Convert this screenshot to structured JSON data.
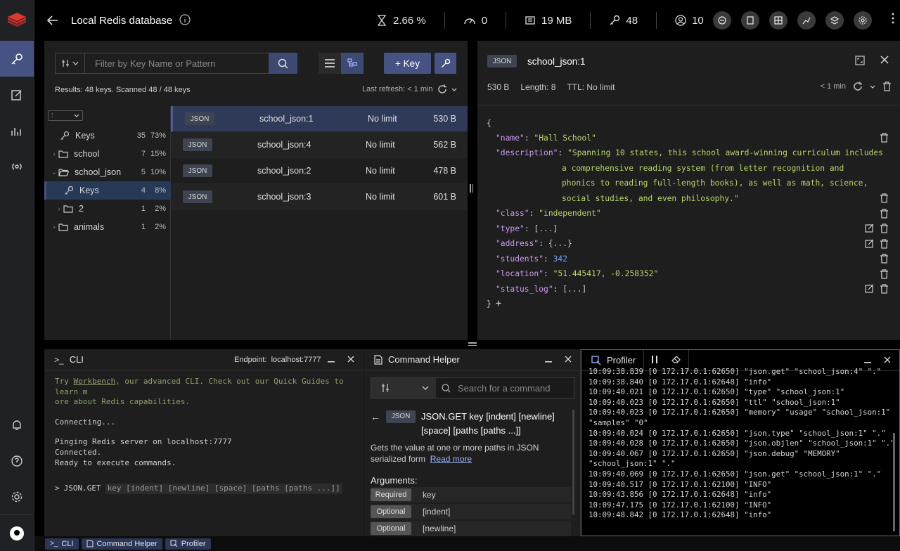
{
  "header": {
    "db_name": "Local Redis database",
    "stats": {
      "cpu": "2.66 %",
      "ops": "0",
      "memory": "19 MB",
      "keys": "48",
      "clients": "10"
    }
  },
  "browser": {
    "filter_placeholder": "Filter by Key Name or Pattern",
    "add_key_label": "+ Key",
    "results_text": "Results: 48 keys. Scanned 48 / 48 keys",
    "last_refresh": "Last refresh: < 1 min",
    "delimiter": ":",
    "tree": [
      {
        "label": "Keys",
        "count": "35",
        "pct": "73%"
      },
      {
        "label": "school",
        "count": "7",
        "pct": "15%"
      },
      {
        "label": "school_json",
        "count": "5",
        "pct": "10%"
      },
      {
        "label": "Keys",
        "count": "4",
        "pct": "8%"
      },
      {
        "label": "2",
        "count": "1",
        "pct": "2%"
      },
      {
        "label": "animals",
        "count": "1",
        "pct": "2%"
      }
    ],
    "keys": [
      {
        "type": "JSON",
        "name": "school_json:1",
        "ttl": "No limit",
        "size": "530 B"
      },
      {
        "type": "JSON",
        "name": "school_json:4",
        "ttl": "No limit",
        "size": "562 B"
      },
      {
        "type": "JSON",
        "name": "school_json:2",
        "ttl": "No limit",
        "size": "478 B"
      },
      {
        "type": "JSON",
        "name": "school_json:3",
        "ttl": "No limit",
        "size": "601 B"
      }
    ]
  },
  "details": {
    "type": "JSON",
    "key_name": "school_json:1",
    "size": "530 B",
    "length": "Length: 8",
    "ttl": "TTL:  No limit",
    "refresh": "< 1 min",
    "json": {
      "open": "{",
      "close": "}",
      "add": "+",
      "name_key": "\"name\"",
      "name_val": "\"Hall School\"",
      "desc_key": "\"description\"",
      "desc_l1": "\"Spanning 10 states, this school award-winning curriculum includes",
      "desc_l2": "a comprehensive reading system (from letter recognition and",
      "desc_l3": "phonics to reading full-length books), as well as math, science,",
      "desc_l4": "social studies, and even philosophy.\"",
      "class_key": "\"class\"",
      "class_val": "\"independent\"",
      "type_key": "\"type\"",
      "type_val": "[...]",
      "address_key": "\"address\"",
      "address_val": "{...}",
      "students_key": "\"students\"",
      "students_val": "342",
      "location_key": "\"location\"",
      "location_val": "\"51.445417, -0.258352\"",
      "status_key": "\"status_log\"",
      "status_val": "[...]"
    }
  },
  "cli": {
    "title": "CLI",
    "endpoint_label": "Endpoint:",
    "endpoint": "localhost:7777",
    "hint_pre": "Try ",
    "hint_link": "Workbench",
    "hint_l1": ", our advanced CLI. Check out our Quick Guides to learn m",
    "hint_l2": "ore about Redis capabilities.",
    "connecting": "Connecting...",
    "pinging": "Pinging Redis server on localhost:7777",
    "connected": "Connected.",
    "ready": "Ready to execute commands.",
    "prompt": ">",
    "command": "JSON.GET",
    "suggestion": "key [indent] [newline] [space] [paths [paths ...]]"
  },
  "helper": {
    "title": "Command Helper",
    "search_placeholder": "Search for a command",
    "cmd_type": "JSON",
    "cmd_signature": "JSON.GET key [indent] [newline] [space] [paths [paths ...]]",
    "description": "Gets the value at one or more paths in JSON serialized form",
    "read_more": "Read more",
    "args_title": "Arguments:",
    "args": [
      {
        "flag": "Required",
        "name": "key"
      },
      {
        "flag": "Optional",
        "name": "[indent]"
      },
      {
        "flag": "Optional",
        "name": "[newline]"
      }
    ]
  },
  "profiler": {
    "title": "Profiler",
    "lines": [
      {
        "ts": "10:09:38.839",
        "src": "[0 172.17.0.1:62650]",
        "cmd": "\"json.get\" \"school_json:4\" \".\""
      },
      {
        "ts": "10:09:38.840",
        "src": "[0 172.17.0.1:62648]",
        "cmd": "\"info\""
      },
      {
        "ts": "10:09:40.021",
        "src": "[0 172.17.0.1:62650]",
        "cmd": "\"type\" \"school_json:1\""
      },
      {
        "ts": "10:09:40.023",
        "src": "[0 172.17.0.1:62650]",
        "cmd": "\"ttl\" \"school_json:1\""
      },
      {
        "ts": "10:09:40.023",
        "src": "[0 172.17.0.1:62650]",
        "cmd": "\"memory\" \"usage\" \"school_json:1\""
      },
      {
        "ts": "",
        "src": "",
        "cmd": "\"samples\" \"0\""
      },
      {
        "ts": "10:09:40.024",
        "src": "[0 172.17.0.1:62650]",
        "cmd": "\"json.type\" \"school_json:1\" \".\""
      },
      {
        "ts": "10:09:40.028",
        "src": "[0 172.17.0.1:62650]",
        "cmd": "\"json.objlen\" \"school_json:1\" \".\""
      },
      {
        "ts": "10:09:40.067",
        "src": "[0 172.17.0.1:62650]",
        "cmd": "\"json.debug\" \"MEMORY\""
      },
      {
        "ts": "",
        "src": "",
        "cmd": "\"school_json:1\" \".\""
      },
      {
        "ts": "10:09:40.069",
        "src": "[0 172.17.0.1:62650]",
        "cmd": "\"json.get\" \"school_json:1\" \".\""
      },
      {
        "ts": "10:09:40.517",
        "src": "[0 172.17.0.1:62100]",
        "cmd": "\"INFO\""
      },
      {
        "ts": "10:09:43.856",
        "src": "[0 172.17.0.1:62648]",
        "cmd": "\"info\""
      },
      {
        "ts": "10:09:47.175",
        "src": "[0 172.17.0.1:62100]",
        "cmd": "\"INFO\""
      },
      {
        "ts": "10:09:48.842",
        "src": "[0 172.17.0.1:62648]",
        "cmd": "\"info\""
      }
    ]
  },
  "bottombar": {
    "cli": "CLI",
    "helper": "Command Helper",
    "profiler": "Profiler"
  },
  "colors": {
    "accent": "#465282",
    "brand": "#dc382c",
    "json_key": "#cc9bf0",
    "json_string": "#b7d56a",
    "json_number": "#6fa3f7"
  }
}
